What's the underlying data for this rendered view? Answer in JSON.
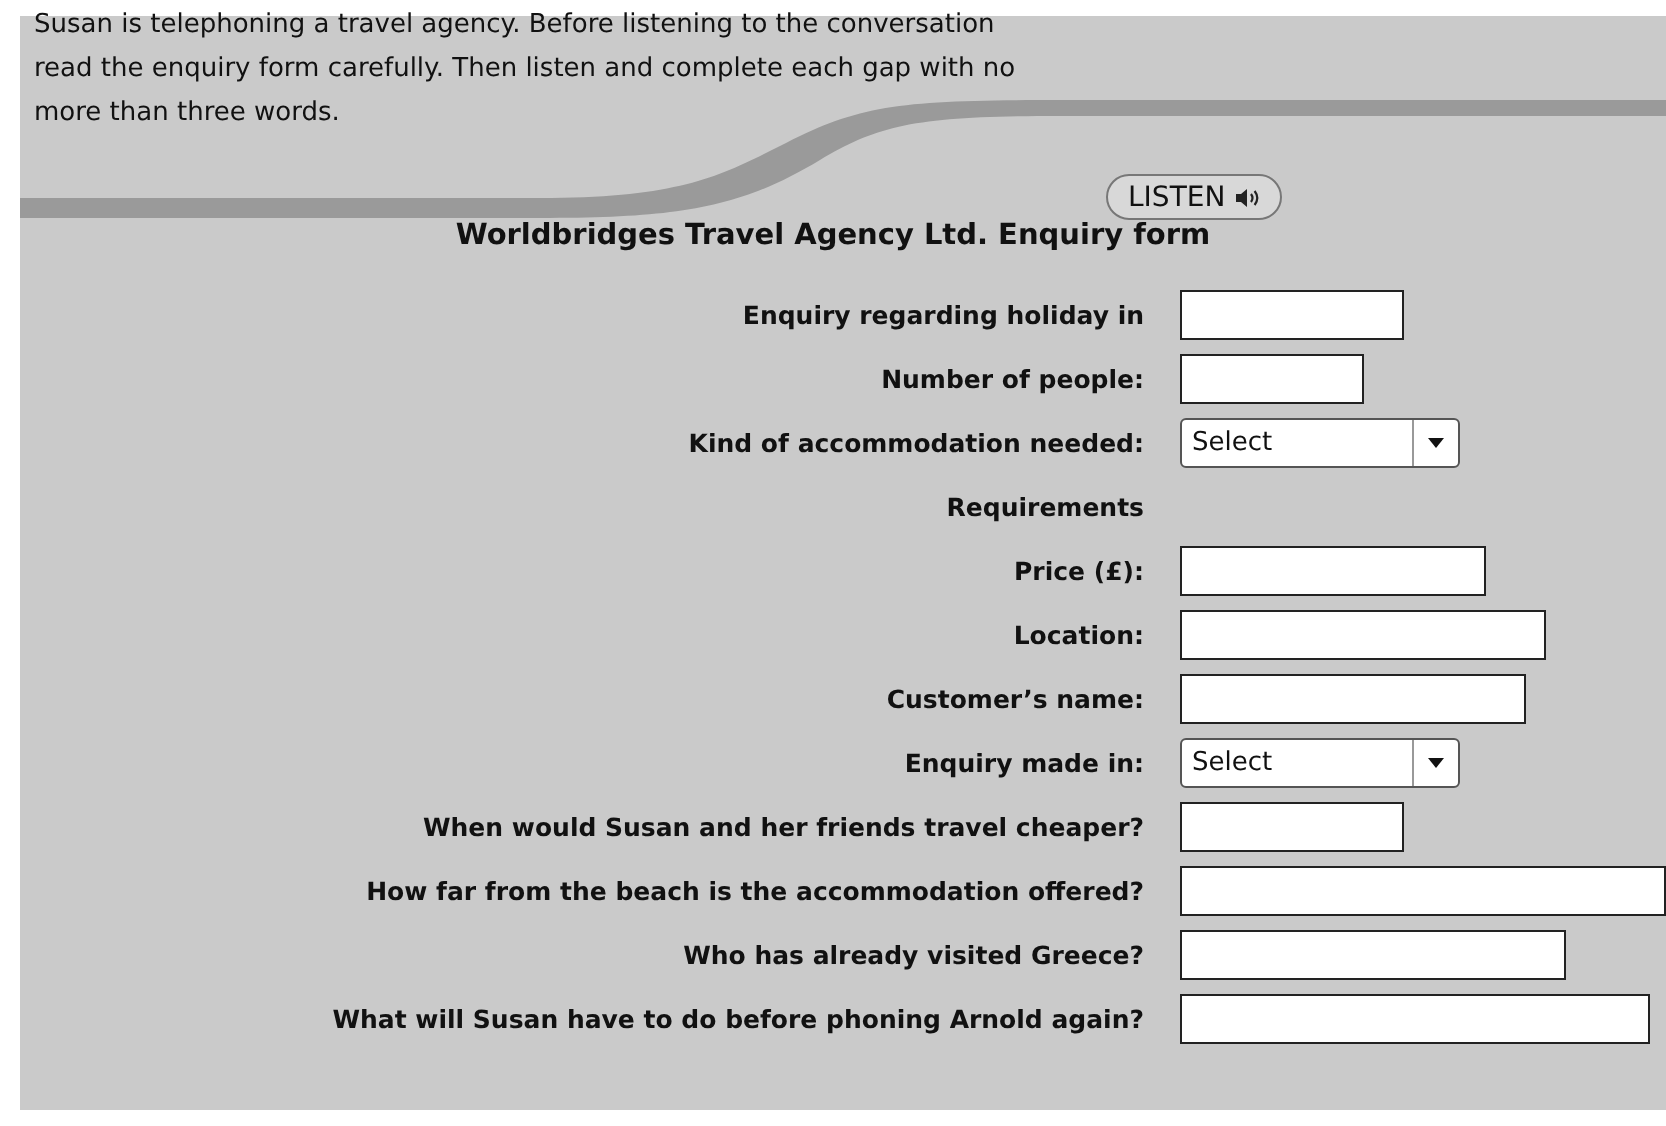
{
  "instructions": "Susan is telephoning a travel agency. Before listening to the conversation read the enquiry form carefully. Then listen and complete each gap with no more than three words.",
  "listen_button": {
    "label": "LISTEN"
  },
  "form": {
    "title": "Worldbridges Travel Agency Ltd. Enquiry form",
    "rows": [
      {
        "kind": "text",
        "label": "Enquiry regarding holiday in"
      },
      {
        "kind": "text",
        "label": "Number of people:"
      },
      {
        "kind": "select",
        "label": "Kind of accommodation needed:",
        "value": "Select"
      },
      {
        "kind": "heading",
        "label": "Requirements"
      },
      {
        "kind": "text",
        "label": "Price (£):"
      },
      {
        "kind": "text",
        "label": "Location:"
      },
      {
        "kind": "text",
        "label": "Customer’s name:"
      },
      {
        "kind": "select",
        "label": "Enquiry made in:",
        "value": "Select"
      },
      {
        "kind": "text",
        "label": "When would Susan and her friends travel cheaper?"
      },
      {
        "kind": "text",
        "label": "How far from the beach is the accommodation offered?"
      },
      {
        "kind": "text",
        "label": "Who has already visited Greece?"
      },
      {
        "kind": "text",
        "label": "What will Susan have to do before phoning Arnold again?"
      }
    ]
  }
}
